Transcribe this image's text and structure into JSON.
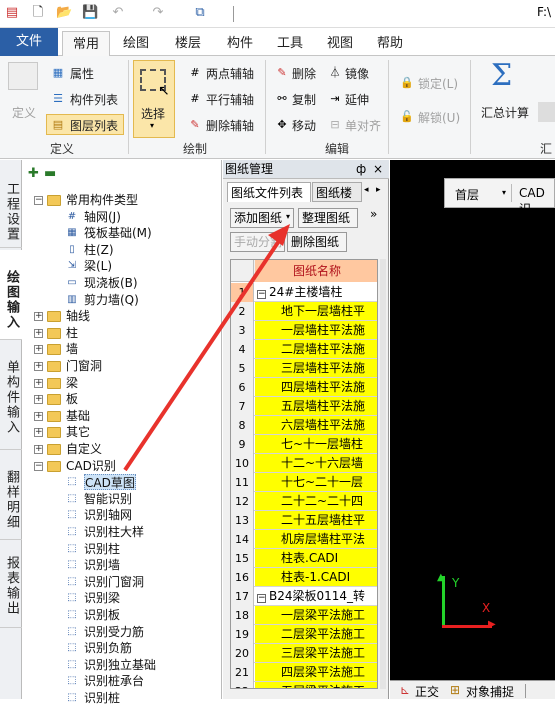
{
  "titlebar": {
    "right_text": "F:\\"
  },
  "ribbon_tabs": [
    "文件",
    "常用",
    "绘图",
    "楼层",
    "构件",
    "工具",
    "视图",
    "帮助"
  ],
  "ribbon": {
    "define_label": "定义",
    "attr_label": "属性",
    "comp_list_label": "构件列表",
    "layer_list_label": "图层列表",
    "define_group": "定义",
    "select_label": "选择",
    "two_point_aux": "两点辅轴",
    "parallel_aux": "平行辅轴",
    "delete_aux": "删除辅轴",
    "draw_group": "绘制",
    "delete": "删除",
    "mirror": "镜像",
    "copy": "复制",
    "extend": "延伸",
    "move": "移动",
    "align": "单对齐",
    "edit_group": "编辑",
    "lock": "锁定(L)",
    "unlock": "解锁(U)",
    "sum_calc": "汇总计算",
    "sum_group": "汇"
  },
  "vertical_tabs": [
    "工程设置",
    "绘图输入",
    "单构件输入",
    "翻样明细",
    "报表输出"
  ],
  "tree": {
    "root": "常用构件类型",
    "common": [
      "轴网(J)",
      "筏板基础(M)",
      "柱(Z)",
      "梁(L)",
      "现浇板(B)",
      "剪力墙(Q)"
    ],
    "folders": [
      "轴线",
      "柱",
      "墙",
      "门窗洞",
      "梁",
      "板",
      "基础",
      "其它",
      "自定义"
    ],
    "cad_folder": "CAD识别",
    "cad_items": [
      "CAD草图",
      "智能识别",
      "识别轴网",
      "识别柱大样",
      "识别柱",
      "识别墙",
      "识别门窗洞",
      "识别梁",
      "识别板",
      "识别受力筋",
      "识别负筋",
      "识别独立基础",
      "识别桩承台",
      "识别桩"
    ]
  },
  "panel": {
    "title": "图纸管理",
    "pin": "ф",
    "close": "×",
    "tab1": "图纸文件列表",
    "tab2": "图纸楼",
    "add_btn": "添加图纸",
    "organize_btn": "整理图纸",
    "split_btn": "手动分割",
    "delete_btn": "删除图纸",
    "more": "»",
    "column_header": "图纸名称",
    "rows": [
      {
        "n": "1",
        "text": "24#主楼墙柱",
        "group": true
      },
      {
        "n": "2",
        "text": "地下一层墙柱平"
      },
      {
        "n": "3",
        "text": "一层墙柱平法施"
      },
      {
        "n": "4",
        "text": "二层墙柱平法施"
      },
      {
        "n": "5",
        "text": "三层墙柱平法施"
      },
      {
        "n": "6",
        "text": "四层墙柱平法施"
      },
      {
        "n": "7",
        "text": "五层墙柱平法施"
      },
      {
        "n": "8",
        "text": "六层墙柱平法施"
      },
      {
        "n": "9",
        "text": "七~十一层墙柱"
      },
      {
        "n": "10",
        "text": "十二~十六层墙"
      },
      {
        "n": "11",
        "text": "十七~二十一层"
      },
      {
        "n": "12",
        "text": "二十二~二十四"
      },
      {
        "n": "13",
        "text": "二十五层墙柱平"
      },
      {
        "n": "14",
        "text": "机房层墙柱平法"
      },
      {
        "n": "15",
        "text": "柱表.CADI"
      },
      {
        "n": "16",
        "text": "柱表-1.CADI"
      },
      {
        "n": "17",
        "text": "B24梁板0114_转",
        "group": true
      },
      {
        "n": "18",
        "text": "一层梁平法施工"
      },
      {
        "n": "19",
        "text": "二层梁平法施工"
      },
      {
        "n": "20",
        "text": "三层梁平法施工"
      },
      {
        "n": "21",
        "text": "四层梁平法施工"
      },
      {
        "n": "22",
        "text": "五层梁平法施工"
      }
    ]
  },
  "canvas": {
    "floor_select": "首层",
    "cad_label": "CAD识",
    "axis_y": "Y",
    "axis_x": "X"
  },
  "statusbar": {
    "ortho": "正交",
    "snap": "对象捕捉"
  },
  "colors": {
    "file_tab": "#2b5fa6",
    "highlight": "#fbe6a9",
    "sheet_yellow": "#ffff00",
    "arrow": "#e8322c"
  }
}
